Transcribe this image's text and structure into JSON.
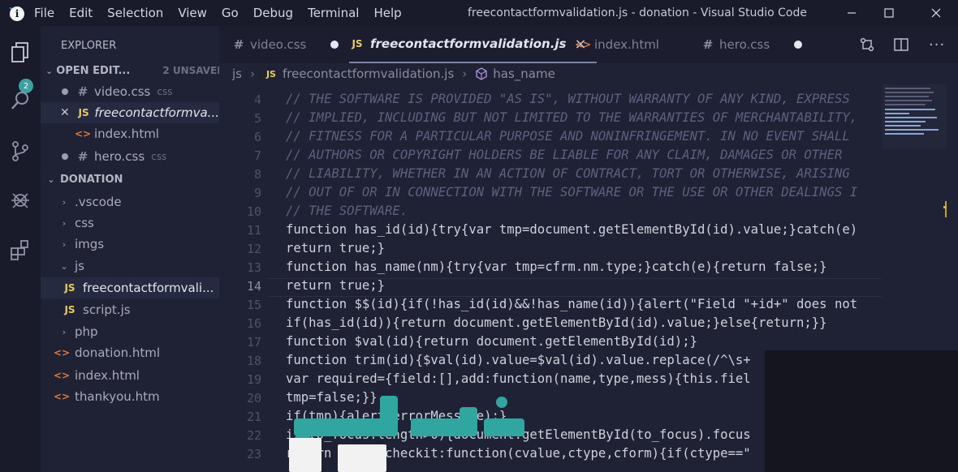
{
  "window": {
    "title": "freecontactformvalidation.js - donation - Visual Studio Code"
  },
  "menu": [
    "File",
    "Edit",
    "Selection",
    "View",
    "Go",
    "Debug",
    "Terminal",
    "Help"
  ],
  "activity": {
    "badge": "2"
  },
  "explorer": {
    "title": "EXPLORER",
    "open_editors": {
      "label": "OPEN EDIT...",
      "status": "2 UNSAVED",
      "items": [
        {
          "name": "video.css",
          "hint": "css"
        },
        {
          "name": "freecontactformva..."
        },
        {
          "name": "index.html"
        },
        {
          "name": "hero.css",
          "hint": "css"
        }
      ]
    },
    "project": {
      "label": "DONATION",
      "items": [
        ".vscode",
        "css",
        "imgs",
        "js",
        "freecontactformvali...",
        "script.js",
        "php",
        "donation.html",
        "index.html",
        "thankyou.htm"
      ]
    }
  },
  "tabs": [
    {
      "label": "video.css"
    },
    {
      "label": "freecontactformvalidation.js",
      "close": "×"
    },
    {
      "label": "index.html"
    },
    {
      "label": "hero.css"
    }
  ],
  "breadcrumb": {
    "folder": "js",
    "file": "freecontactformvalidation.js",
    "symbol": "has_name"
  },
  "editor": {
    "line_numbers": [
      "4",
      "5",
      "6",
      "7",
      "8",
      "9",
      "10",
      "11",
      "12",
      "13",
      "14",
      "15",
      "16",
      "17",
      "18",
      "19",
      "20",
      "21",
      "22",
      "23"
    ],
    "lines": [
      "// THE SOFTWARE IS PROVIDED \"AS IS\", WITHOUT WARRANTY OF ANY KIND, EXPRESS",
      "// IMPLIED, INCLUDING BUT NOT LIMITED TO THE WARRANTIES OF MERCHANTABILITY,",
      "// FITNESS FOR A PARTICULAR PURPOSE AND NONINFRINGEMENT. IN NO EVENT SHALL",
      "// AUTHORS OR COPYRIGHT HOLDERS BE LIABLE FOR ANY CLAIM, DAMAGES OR OTHER",
      "// LIABILITY, WHETHER IN AN ACTION OF CONTRACT, TORT OR OTHERWISE, ARISING",
      "// OUT OF OR IN CONNECTION WITH THE SOFTWARE OR THE USE OR OTHER DEALINGS I",
      "// THE SOFTWARE.",
      "function has_id(id){try{var tmp=document.getElementById(id).value;}catch(e)",
      "return true;}",
      "function has_name(nm){try{var tmp=cfrm.nm.type;}catch(e){return false;}",
      "return true;}",
      "function $$(id){if(!has_id(id)&&!has_name(id)){alert(\"Field \"+id+\" does not",
      "if(has_id(id)){return document.getElementById(id).value;}else{return;}}",
      "function $val(id){return document.getElementById(id);}",
      "function trim(id){$val(id).value=$val(id).value.replace(/^\\s+",
      "var required={field:[],add:function(name,type,mess){this.fiel",
      "tmp=false;}}",
      "if(tmp){alert(errorMessage);}",
      "if(to_focus.length>0){document.getElementById(to_focus).focus",
      "return tmp;},checkit:function(cvalue,ctype,cform){if(ctype==\""
    ]
  },
  "brand": {
    "watermark": "فوكك"
  },
  "colors": {
    "background": "#1f2134",
    "accent": "#2f8fe0",
    "keyword": "#9fc1ff",
    "comment": "#5d6180",
    "badge": "#3aa3a0"
  }
}
